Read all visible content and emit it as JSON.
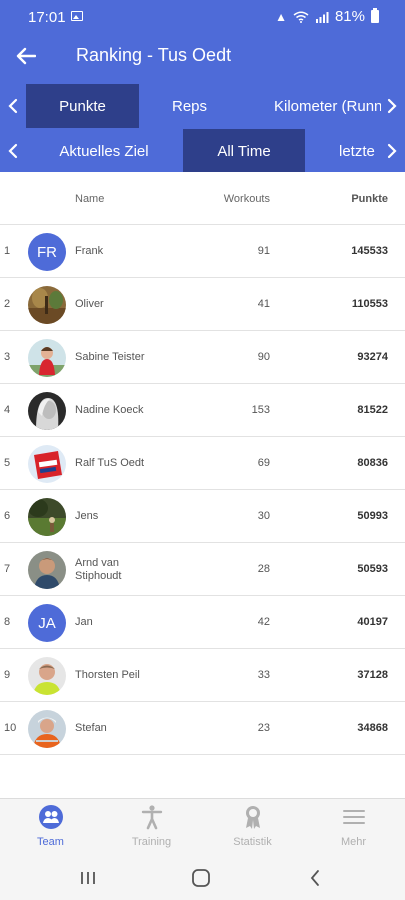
{
  "status": {
    "time": "17:01",
    "battery": "81%"
  },
  "appbar": {
    "title": "Ranking - Tus Oedt"
  },
  "tabs_metric": [
    {
      "label": "Punkte",
      "active": true
    },
    {
      "label": "Reps",
      "active": false
    },
    {
      "label": "Kilometer (Runn",
      "active": false
    }
  ],
  "tabs_period": [
    {
      "label": "Aktuelles Ziel",
      "active": false
    },
    {
      "label": "All Time",
      "active": true
    },
    {
      "label": "letzte",
      "active": false
    }
  ],
  "table": {
    "headers": {
      "name": "Name",
      "workouts": "Workouts",
      "points": "Punkte"
    },
    "rows": [
      {
        "rank": "1",
        "name": "Frank",
        "avatar": "FR",
        "workouts": "91",
        "points": "145533"
      },
      {
        "rank": "2",
        "name": "Oliver",
        "avatar": "photo",
        "workouts": "41",
        "points": "110553"
      },
      {
        "rank": "3",
        "name": "Sabine Teister",
        "avatar": "photo",
        "workouts": "90",
        "points": "93274"
      },
      {
        "rank": "4",
        "name": "Nadine Koeck",
        "avatar": "photo",
        "workouts": "153",
        "points": "81522"
      },
      {
        "rank": "5",
        "name": "Ralf TuS Oedt",
        "avatar": "photo",
        "workouts": "69",
        "points": "80836"
      },
      {
        "rank": "6",
        "name": "Jens",
        "avatar": "photo",
        "workouts": "30",
        "points": "50993"
      },
      {
        "rank": "7",
        "name": "Arnd van Stiphoudt",
        "avatar": "photo",
        "workouts": "28",
        "points": "50593"
      },
      {
        "rank": "8",
        "name": "Jan",
        "avatar": "JA",
        "workouts": "42",
        "points": "40197"
      },
      {
        "rank": "9",
        "name": "Thorsten Peil",
        "avatar": "photo",
        "workouts": "33",
        "points": "37128"
      },
      {
        "rank": "10",
        "name": "Stefan",
        "avatar": "photo",
        "workouts": "23",
        "points": "34868"
      }
    ]
  },
  "bottom_nav": [
    {
      "label": "Team",
      "icon": "team-icon",
      "active": true
    },
    {
      "label": "Training",
      "icon": "training-icon",
      "active": false
    },
    {
      "label": "Statistik",
      "icon": "statistik-icon",
      "active": false
    },
    {
      "label": "Mehr",
      "icon": "menu-icon",
      "active": false
    }
  ],
  "colors": {
    "primary": "#4e6bd8",
    "active_tab": "#2e3f8a",
    "nav_inactive": "#b0b0b0"
  }
}
